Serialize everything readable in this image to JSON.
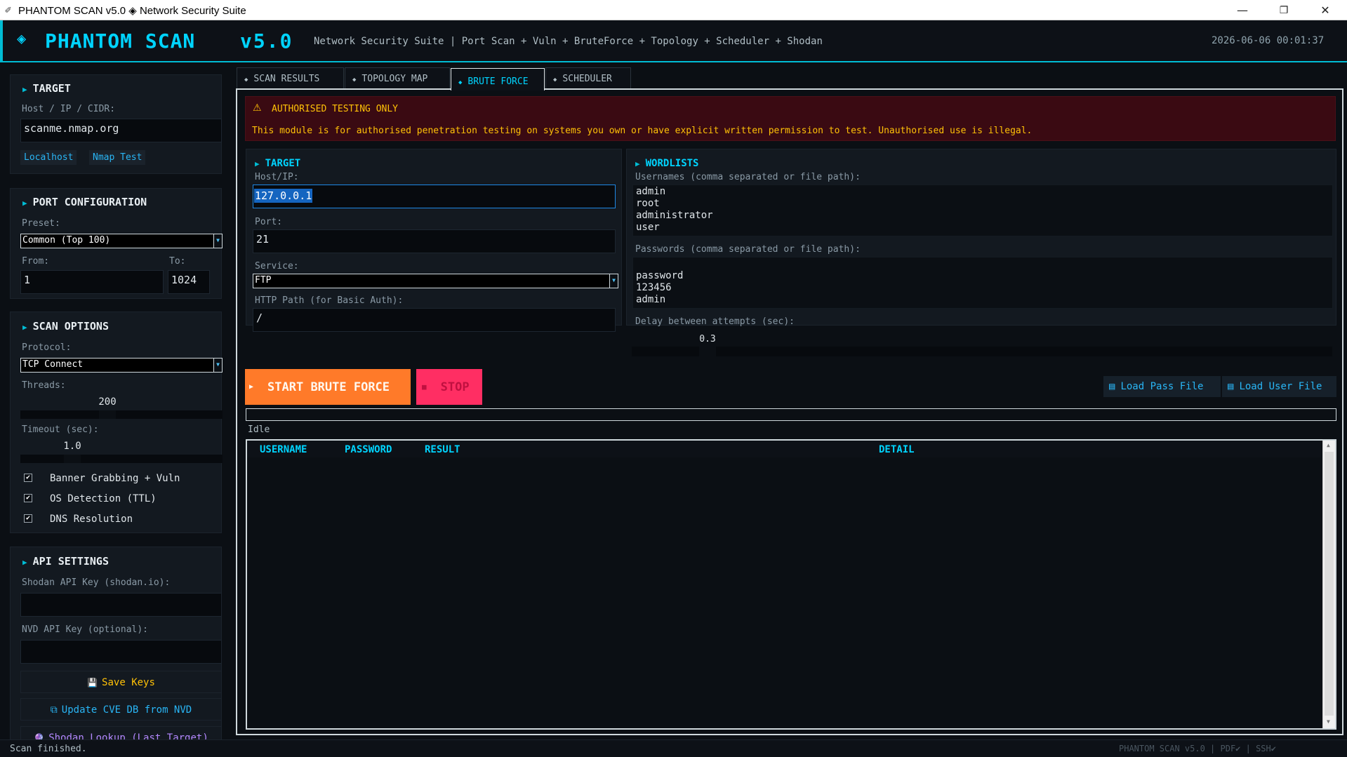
{
  "window": {
    "title": "PHANTOM SCAN v5.0  ◈  Network Security Suite",
    "minimize": "—",
    "maximize": "❐",
    "close": "✕"
  },
  "header": {
    "logo_glyph": "◈",
    "title": "PHANTOM SCAN",
    "version": "v5.0",
    "subtitle": "Network Security Suite | Port Scan + Vuln + BruteForce + Topology + Scheduler + Shodan",
    "datetime": "2026-06-06   00:01:37"
  },
  "sidebar": {
    "target": {
      "heading": "TARGET",
      "label": "Host / IP / CIDR:",
      "value": "scanme.nmap.org",
      "quick": [
        "Localhost",
        "Nmap Test"
      ]
    },
    "ports": {
      "heading": "PORT CONFIGURATION",
      "preset_label": "Preset:",
      "preset_value": "Common (Top 100)",
      "from_label": "From:",
      "from_value": "1",
      "to_label": "To:",
      "to_value": "1024"
    },
    "scan_options": {
      "heading": "SCAN OPTIONS",
      "protocol_label": "Protocol:",
      "protocol_value": "TCP Connect",
      "threads_label": "Threads:",
      "threads_value": "200",
      "timeout_label": "Timeout (sec):",
      "timeout_value": "1.0",
      "checks": [
        {
          "label": "Banner Grabbing + Vuln",
          "checked": true
        },
        {
          "label": "OS Detection (TTL)",
          "checked": true
        },
        {
          "label": "DNS Resolution",
          "checked": true
        }
      ],
      "check_glyph": "✔"
    },
    "api": {
      "heading": "API SETTINGS",
      "shodan_label": "Shodan API Key (shodan.io):",
      "shodan_value": "",
      "nvd_label": "NVD API Key (optional):",
      "nvd_value": "",
      "save_icon": "💾",
      "save_label": "Save Keys",
      "update_icon": "⧉",
      "update_label": "Update CVE DB from NVD",
      "shodan_icon": "🔮",
      "shodan_lookup_label": "Shodan Lookup (Last Target)"
    }
  },
  "tabs": [
    {
      "label": "SCAN RESULTS",
      "active": false
    },
    {
      "label": "TOPOLOGY MAP",
      "active": false
    },
    {
      "label": "BRUTE FORCE",
      "active": true
    },
    {
      "label": "SCHEDULER",
      "active": false
    }
  ],
  "tab_glyph": "◆",
  "brute": {
    "warning": {
      "icon": "⚠",
      "title": "AUTHORISED TESTING ONLY",
      "text": "This module is for authorised penetration testing on systems you own or have explicit written permission to test. Unauthorised use is illegal."
    },
    "target": {
      "heading": "TARGET",
      "host_label": "Host/IP:",
      "host_value": "127.0.0.1",
      "port_label": "Port:",
      "port_value": "21",
      "service_label": "Service:",
      "service_value": "FTP",
      "path_label": "HTTP Path (for Basic Auth):",
      "path_value": "/"
    },
    "wordlists": {
      "heading": "WORDLISTS",
      "users_label": "Usernames (comma separated or file path):",
      "users_value": "admin\nroot\nadministrator\nuser",
      "pass_label": "Passwords (comma separated or file path):",
      "pass_value": "\npassword\n123456\nadmin",
      "delay_label": "Delay between attempts (sec):",
      "delay_value": "0.3"
    },
    "start_icon": "▶",
    "start_label": "START BRUTE FORCE",
    "stop_icon": "■",
    "stop_label": "STOP",
    "load_pass_icon": "▤",
    "load_pass_label": "Load Pass File",
    "load_user_icon": "▤",
    "load_user_label": "Load User File",
    "progress": 0,
    "status": "Idle",
    "columns": [
      "USERNAME",
      "PASSWORD",
      "RESULT",
      "DETAIL"
    ],
    "rows": []
  },
  "statusbar": {
    "left": "Scan finished.",
    "right": "PHANTOM SCAN v5.0   |   PDF✔   |   SSH✔"
  },
  "colors": {
    "accent": "#00d4ff",
    "danger_bg": "#3a0a12",
    "warn_text": "#ffc107",
    "start_btn": "#ff7a29",
    "stop_btn": "#ff2e63"
  }
}
